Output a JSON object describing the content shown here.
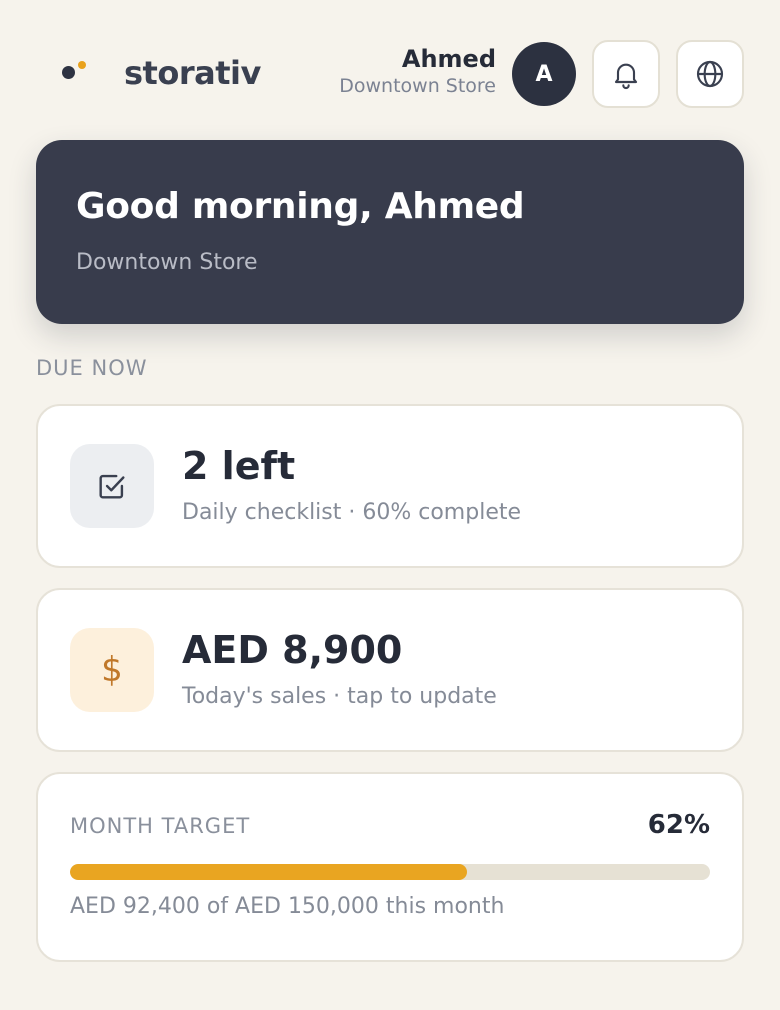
{
  "header": {
    "brand": "storativ",
    "user_name": "Ahmed",
    "user_store": "Downtown Store",
    "avatar_initial": "A",
    "icons": {
      "notifications": "bell-icon",
      "language": "globe-icon",
      "logo": "logo-dots-icon"
    }
  },
  "hero": {
    "greeting": "Good morning, Ahmed",
    "store": "Downtown Store"
  },
  "section": {
    "due_now_label": "DUE NOW"
  },
  "checklist_card": {
    "value": "2 left",
    "subtitle": "Daily checklist · 60% complete",
    "icon": "checklist-icon"
  },
  "sales_card": {
    "value": "AED 8,900",
    "subtitle": "Today's sales · tap to update",
    "icon": "dollar-icon"
  },
  "target_card": {
    "label": "MONTH TARGET",
    "percent_label": "62%",
    "progress": 0.62,
    "note": "AED 92,400 of AED 150,000 this month"
  },
  "colors": {
    "background": "#f6f3ec",
    "hero": "#383c4c",
    "accent": "#e9a521",
    "text_dark": "#262b38",
    "text_muted": "#858b97"
  }
}
